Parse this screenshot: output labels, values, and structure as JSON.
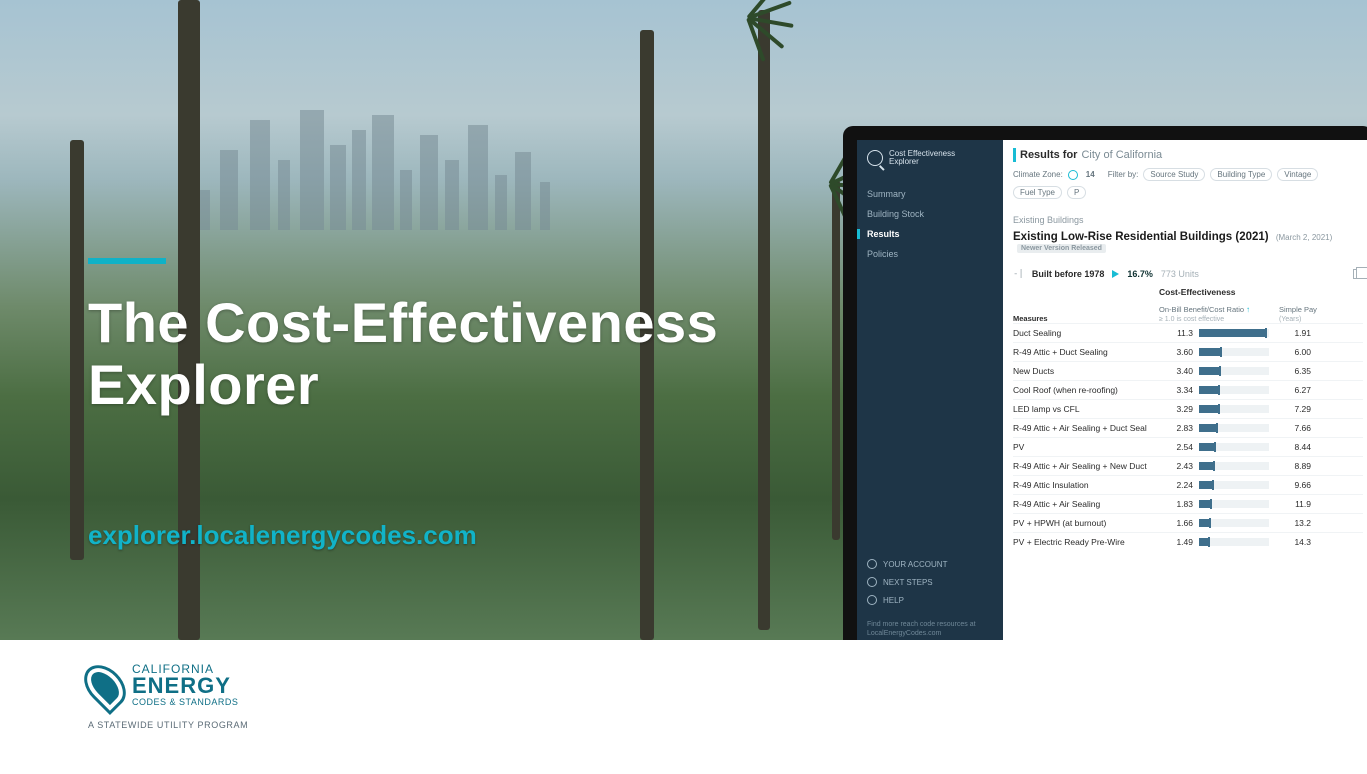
{
  "hero": {
    "title_line1": "The Cost-Effectiveness",
    "title_line2": "Explorer",
    "url": "explorer.localenergycodes.com"
  },
  "footer_logo": {
    "line1": "CALIFORNIA",
    "line2": "ENERGY",
    "line3": "CODES & STANDARDS",
    "tagline": "A STATEWIDE UTILITY PROGRAM"
  },
  "app": {
    "brand_line1": "Cost Effectiveness",
    "brand_line2": "Explorer",
    "nav": {
      "summary": "Summary",
      "building_stock": "Building Stock",
      "results": "Results",
      "policies": "Policies"
    },
    "sidebar_links": {
      "account": "YOUR ACCOUNT",
      "next": "NEXT STEPS",
      "help": "HELP"
    },
    "sidebar_footer_1": "Find more reach code resources at",
    "sidebar_footer_2": "LocalEnergyCodes.com",
    "header": {
      "results_for": "Results for",
      "city": "City of California",
      "climate_label": "Climate Zone:",
      "climate_value": "14",
      "filter_label": "Filter by:",
      "chips": {
        "source": "Source Study",
        "building": "Building Type",
        "vintage": "Vintage",
        "fuel": "Fuel Type",
        "p": "P"
      }
    },
    "section": {
      "eyebrow": "Existing Buildings",
      "title": "Existing Low-Rise Residential Buildings (2021)",
      "date": "(March 2, 2021)",
      "pill": "Newer Version Released"
    },
    "group": {
      "label": "Built before 1978",
      "pct": "16.7%",
      "units": "773 Units"
    },
    "table": {
      "group_header": "Cost-Effectiveness",
      "col_measures": "Measures",
      "col_ratio": "On-Bill Benefit/Cost Ratio",
      "col_ratio_sub": "≥ 1.0 is cost effective",
      "col_payback": "Simple Pay",
      "col_payback_sub": "(Years)"
    },
    "chart_data": {
      "type": "table",
      "columns": [
        "measure",
        "ratio",
        "payback_years"
      ],
      "ratio_bar_max": 12,
      "rows": [
        {
          "measure": "Duct Sealing",
          "ratio": 11.3,
          "payback_years": 1.91
        },
        {
          "measure": "R-49 Attic + Duct Sealing",
          "ratio": 3.6,
          "payback_years": 6.0
        },
        {
          "measure": "New Ducts",
          "ratio": 3.4,
          "payback_years": 6.35
        },
        {
          "measure": "Cool Roof (when re-roofing)",
          "ratio": 3.34,
          "payback_years": 6.27
        },
        {
          "measure": "LED lamp vs CFL",
          "ratio": 3.29,
          "payback_years": 7.29
        },
        {
          "measure": "R-49 Attic + Air Sealing + Duct Seal",
          "ratio": 2.83,
          "payback_years": 7.66
        },
        {
          "measure": "PV",
          "ratio": 2.54,
          "payback_years": 8.44
        },
        {
          "measure": "R-49 Attic + Air Sealing + New Duct",
          "ratio": 2.43,
          "payback_years": 8.89
        },
        {
          "measure": "R-49 Attic Insulation",
          "ratio": 2.24,
          "payback_years": 9.66
        },
        {
          "measure": "R-49 Attic + Air Sealing",
          "ratio": 1.83,
          "payback_years": 11.9
        },
        {
          "measure": "PV + HPWH (at burnout)",
          "ratio": 1.66,
          "payback_years": 13.2
        },
        {
          "measure": "PV + Electric Ready Pre-Wire",
          "ratio": 1.49,
          "payback_years": 14.3
        }
      ]
    }
  }
}
